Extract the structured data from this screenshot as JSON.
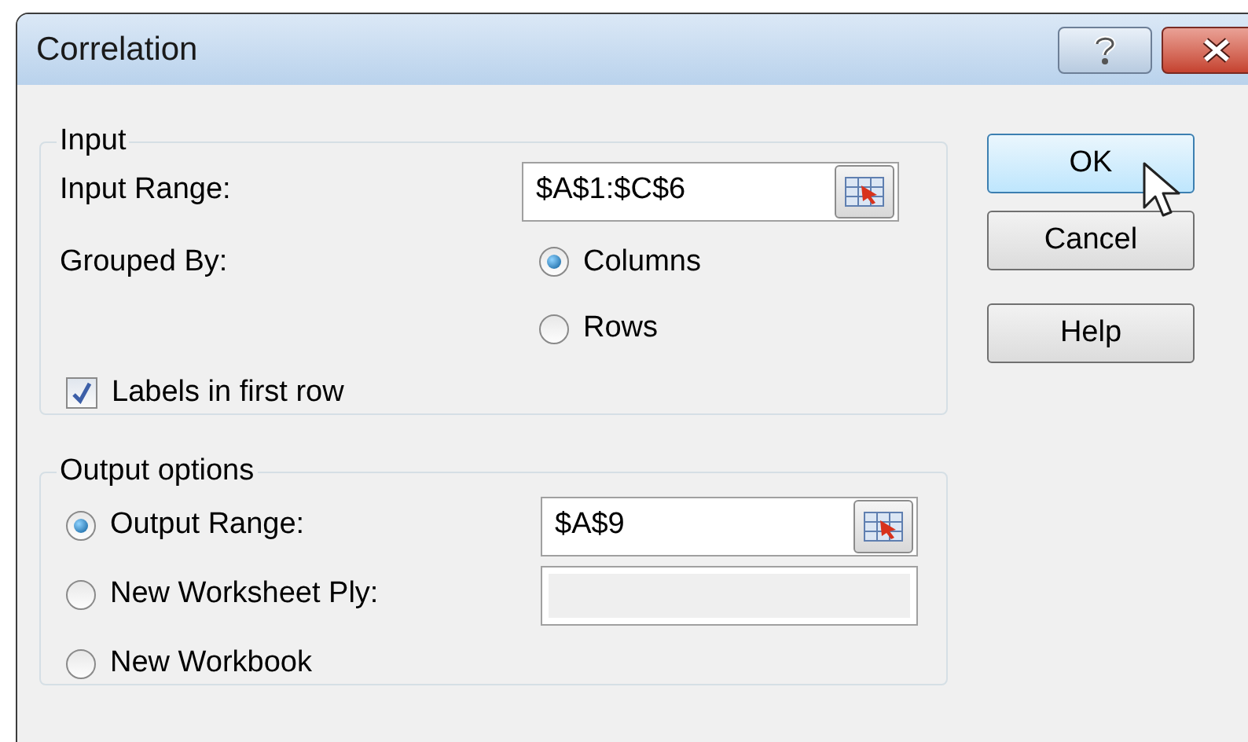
{
  "window": {
    "title": "Correlation"
  },
  "input": {
    "legend": "Input",
    "input_range": {
      "label": "Input Range:",
      "value": "$A$1:$C$6"
    },
    "grouped_by": {
      "label": "Grouped By:",
      "options": [
        {
          "label": "Columns",
          "selected": true
        },
        {
          "label": "Rows",
          "selected": false
        }
      ]
    },
    "labels_in_first_row": {
      "label": "Labels in first row",
      "checked": true
    }
  },
  "output": {
    "legend": "Output options",
    "options": [
      {
        "label": "Output Range:",
        "selected": true,
        "kind": "range",
        "value": "$A$9"
      },
      {
        "label": "New Worksheet Ply:",
        "selected": false,
        "kind": "text"
      },
      {
        "label": "New Workbook",
        "selected": false,
        "kind": "none"
      }
    ]
  },
  "buttons": [
    {
      "label": "OK",
      "hovered": true
    },
    {
      "label": "Cancel",
      "hovered": false
    },
    {
      "label": "Help",
      "hovered": false
    }
  ]
}
